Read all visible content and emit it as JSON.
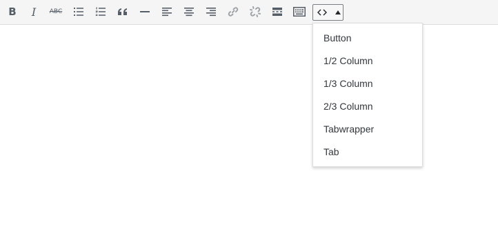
{
  "toolbar": {
    "buttons": [
      {
        "id": "bold",
        "glyph": "B",
        "icon": "bold-icon"
      },
      {
        "id": "italic",
        "glyph": "I",
        "icon": "italic-icon"
      },
      {
        "id": "strikethrough",
        "glyph": "ABC",
        "icon": "strikethrough-icon"
      },
      {
        "id": "bulleted-list",
        "icon": "bulleted-list-icon"
      },
      {
        "id": "numbered-list",
        "icon": "numbered-list-icon"
      },
      {
        "id": "blockquote",
        "icon": "blockquote-icon"
      },
      {
        "id": "horizontal-line",
        "icon": "horizontal-line-icon"
      },
      {
        "id": "align-left",
        "icon": "align-left-icon"
      },
      {
        "id": "align-center",
        "icon": "align-center-icon"
      },
      {
        "id": "align-right",
        "icon": "align-right-icon"
      },
      {
        "id": "insert-link",
        "icon": "link-icon",
        "disabled": true
      },
      {
        "id": "remove-link",
        "icon": "unlink-icon",
        "disabled": true
      },
      {
        "id": "read-more",
        "icon": "read-more-icon"
      },
      {
        "id": "toolbar-toggle",
        "icon": "keyboard-icon"
      }
    ],
    "shortcode_menu": {
      "icon": "code-icon",
      "caret_icon": "caret-up-icon",
      "expanded": true
    }
  },
  "dropdown": {
    "items": [
      {
        "label": "Button"
      },
      {
        "label": "1/2 Column"
      },
      {
        "label": "1/3 Column"
      },
      {
        "label": "2/3 Column"
      },
      {
        "label": "Tabwrapper"
      },
      {
        "label": "Tab"
      }
    ]
  },
  "colors": {
    "toolbar_bg": "#f5f5f5",
    "icon": "#555d66",
    "icon_disabled": "#a0a5aa",
    "menu_text": "#32373c",
    "border": "#dddddd"
  }
}
